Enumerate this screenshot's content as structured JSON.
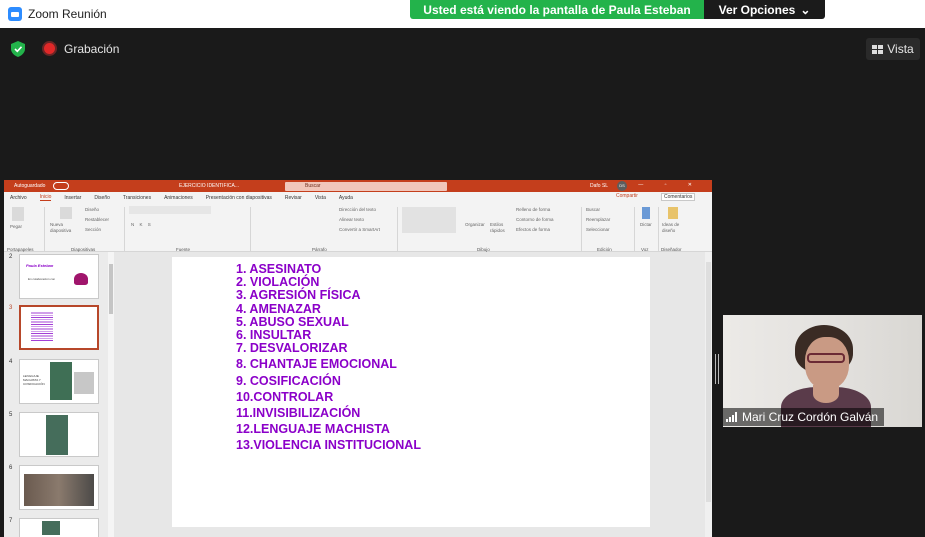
{
  "window": {
    "title": "Zoom Reunión"
  },
  "share_banner": {
    "text": "Usted está viendo la pantalla de Paula Esteban",
    "options_label": "Ver Opciones"
  },
  "toolbar": {
    "recording_label": "Grabación",
    "view_label": "Vista"
  },
  "ppt": {
    "autosave": "Autoguardado",
    "filename": "EJERCICIO IDENTIFICA...",
    "search_placeholder": "Buscar",
    "user": "Dafo SL",
    "user_initials": "DS",
    "tabs": [
      "Archivo",
      "Inicio",
      "Insertar",
      "Diseño",
      "Transiciones",
      "Animaciones",
      "Presentación con diapositivas",
      "Revisar",
      "Vista",
      "Ayuda"
    ],
    "share_label": "Compartir",
    "comments_label": "Comentarios",
    "ribbon": {
      "paste": "Pegar",
      "new_slide": "Nueva diapositiva",
      "layout": "Diseño",
      "reset": "Restablecer",
      "section": "Sección",
      "font_buttons": "N K S",
      "text_direction": "Dirección del texto",
      "align_text": "Alinear texto",
      "smartart": "Convertir a SmartArt",
      "arrange": "Organizar",
      "quick_styles": "Estilos rápidos",
      "shape_fill": "Relleno de forma",
      "shape_outline": "Contorno de forma",
      "shape_effects": "Efectos de forma",
      "find": "Buscar",
      "replace": "Reemplazar",
      "select": "Seleccionar",
      "dictate": "Dictar",
      "design_ideas": "Ideas de diseño",
      "groups": [
        "Portapapeles",
        "Diapositivas",
        "Fuente",
        "Párrafo",
        "Dibujo",
        "Edición",
        "Voz",
        "Diseñador"
      ]
    },
    "thumbnails": [
      {
        "num": "2",
        "title": "Paula Esteban",
        "subtitle": "En colaboración con"
      },
      {
        "num": "3"
      },
      {
        "num": "4",
        "text": "LENGUAJE MACHISTA Y COSIFICACIÓN"
      },
      {
        "num": "5"
      },
      {
        "num": "6"
      },
      {
        "num": "7"
      }
    ],
    "slide_items": [
      "1.  ASESINATO",
      "2.  VIOLACIÓN",
      "3.  AGRESIÓN FÍSICA",
      "4.  AMENAZAR",
      "5.  ABUSO SEXUAL",
      "6.  INSULTAR",
      "7.  DESVALORIZAR",
      "8.  CHANTAJE EMOCIONAL",
      "9.  COSIFICACIÓN",
      "10.CONTROLAR",
      "11.INVISIBILIZACIÓN",
      "12.LENGUAJE MACHISTA",
      "13.VIOLENCIA INSTITUCIONAL"
    ],
    "slide_text_color": "#8b00c9"
  },
  "participant": {
    "name": "Mari Cruz Cordón Galván"
  },
  "colors": {
    "banner_green": "#23b34b",
    "ppt_red": "#c43e1c",
    "zoom_blue": "#2d8cff"
  }
}
